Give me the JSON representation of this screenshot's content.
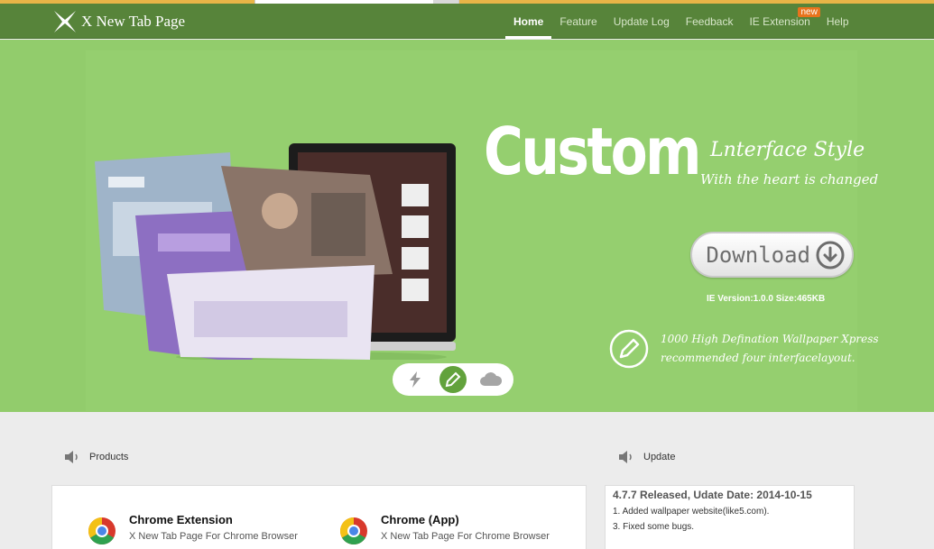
{
  "header": {
    "logo_text": "X New Tab Page",
    "nav": [
      {
        "label": "Home"
      },
      {
        "label": "Feature"
      },
      {
        "label": "Update Log"
      },
      {
        "label": "Feedback"
      },
      {
        "label": "IE Extension",
        "badge": "new"
      },
      {
        "label": "Help"
      }
    ]
  },
  "hero": {
    "title": "Custom",
    "subtitle_1": "Lnterface Style",
    "subtitle_2": "With the heart is changed",
    "download_label": "Download",
    "version_line": "IE Version:1.0.0   Size:465KB",
    "feature_line_1": "1000 High Defination Wallpaper Xpress",
    "feature_line_2": "recommended four interfacelayout.",
    "switcher": [
      "lightning-icon",
      "pencil-icon",
      "cloud-icon"
    ]
  },
  "sections": {
    "products_label": "Products",
    "update_label": "Update"
  },
  "products": [
    {
      "name": "Chrome Extension",
      "desc": "X New Tab Page For Chrome Browser"
    },
    {
      "name": "Chrome (App)",
      "desc": "X New Tab Page For Chrome Browser"
    }
  ],
  "update": {
    "title": "4.7.7 Released, Udate Date: 2014-10-15",
    "lines": [
      "1. Added wallpaper website(like5.com).",
      "3. Fixed some bugs."
    ]
  },
  "colors": {
    "header_bg": "#57843a",
    "hero_bg": "#92cc6c",
    "accent_orange": "#e8731c",
    "page_bg": "#ececec"
  }
}
